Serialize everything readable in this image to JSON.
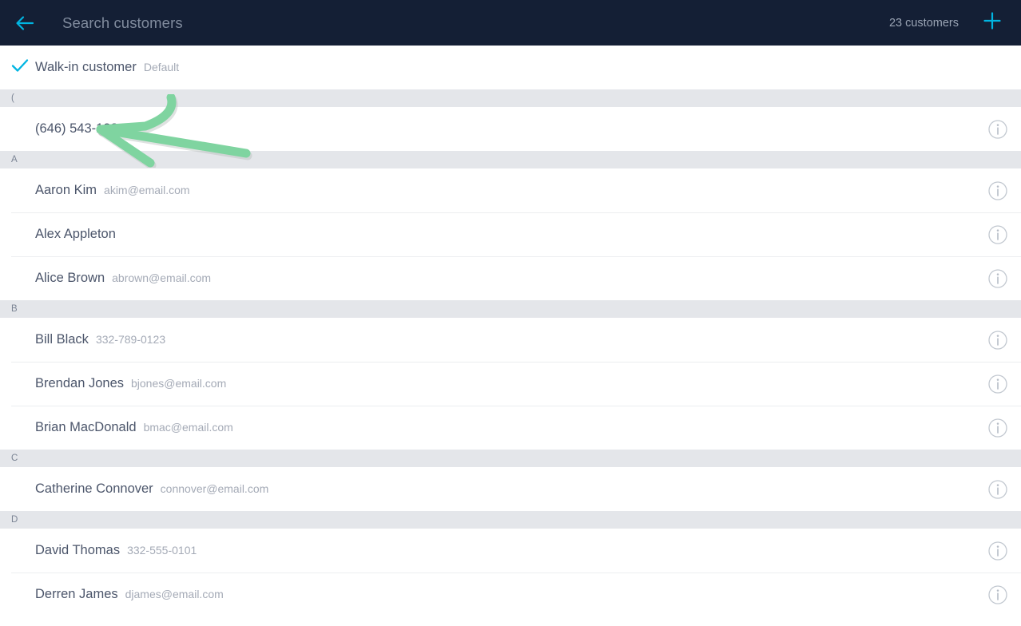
{
  "header": {
    "back_icon": "arrow-left-icon",
    "search_placeholder": "Search customers",
    "search_value": "",
    "customer_count": "23 customers",
    "add_icon": "plus-icon",
    "background_color": "#141f35",
    "accent_color": "#00b5e2"
  },
  "default_row": {
    "check_icon": "check-icon",
    "title": "Walk-in customer",
    "subtitle": "Default",
    "selected": true
  },
  "list": [
    {
      "type": "section",
      "letter": "("
    },
    {
      "type": "customer",
      "title": "(646) 543-1234",
      "subtitle": "",
      "info_icon": "info-circle-icon"
    },
    {
      "type": "section",
      "letter": "A"
    },
    {
      "type": "customer",
      "title": "Aaron Kim",
      "subtitle": "akim@email.com",
      "info_icon": "info-circle-icon"
    },
    {
      "type": "customer",
      "title": "Alex Appleton",
      "subtitle": "",
      "info_icon": "info-circle-icon"
    },
    {
      "type": "customer",
      "title": "Alice Brown",
      "subtitle": "abrown@email.com",
      "info_icon": "info-circle-icon"
    },
    {
      "type": "section",
      "letter": "B"
    },
    {
      "type": "customer",
      "title": "Bill Black",
      "subtitle": "332-789-0123",
      "info_icon": "info-circle-icon"
    },
    {
      "type": "customer",
      "title": "Brendan Jones",
      "subtitle": "bjones@email.com",
      "info_icon": "info-circle-icon"
    },
    {
      "type": "customer",
      "title": "Brian MacDonald",
      "subtitle": "bmac@email.com",
      "info_icon": "info-circle-icon"
    },
    {
      "type": "section",
      "letter": "C"
    },
    {
      "type": "customer",
      "title": "Catherine Connover",
      "subtitle": "connover@email.com",
      "info_icon": "info-circle-icon"
    },
    {
      "type": "section",
      "letter": "D"
    },
    {
      "type": "customer",
      "title": "David Thomas",
      "subtitle": "332-555-0101",
      "info_icon": "info-circle-icon"
    },
    {
      "type": "customer",
      "title": "Derren James",
      "subtitle": "djames@email.com",
      "info_icon": "info-circle-icon"
    }
  ],
  "annotation": {
    "shape": "arrow-left-annotation",
    "color": "#7fd4a0",
    "points_at": "(646) 543-1234"
  }
}
